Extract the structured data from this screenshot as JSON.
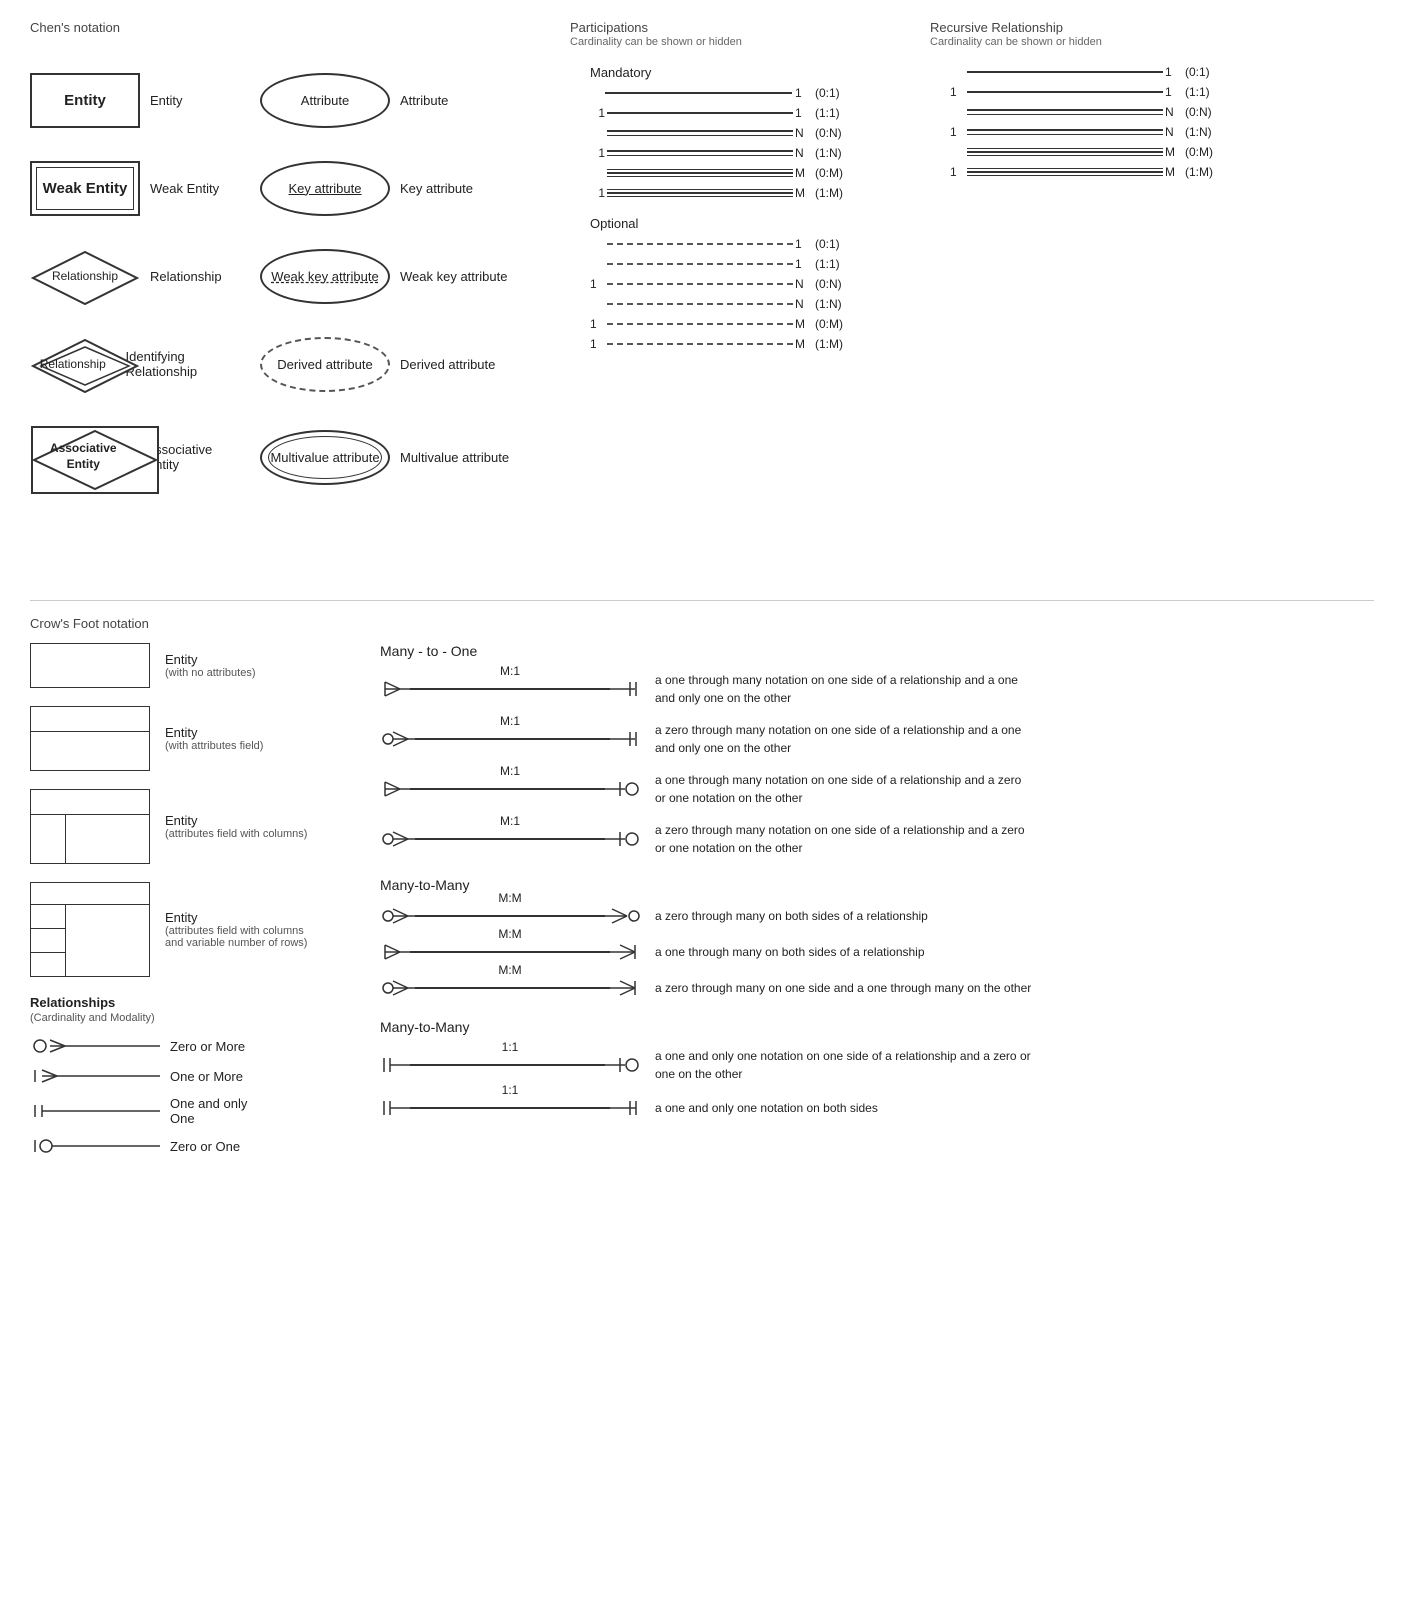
{
  "chens": {
    "title": "Chen's notation",
    "entities": [
      {
        "shape": "entity",
        "label": "Entity",
        "desc": "Entity"
      },
      {
        "shape": "weak-entity",
        "label": "Weak Entity",
        "desc": "Weak Entity"
      },
      {
        "shape": "relationship",
        "label": "Relationship",
        "desc": "Relationship"
      },
      {
        "shape": "identifying-relationship",
        "label": "Relationship",
        "desc": "Identifying Relationship"
      },
      {
        "shape": "associative-entity",
        "label": "Associative\nEntity",
        "desc": "Associative Entity"
      }
    ],
    "attributes": [
      {
        "shape": "attribute",
        "label": "Attribute",
        "desc": "Attribute"
      },
      {
        "shape": "key",
        "label": "Key attribute",
        "desc": "Key attribute"
      },
      {
        "shape": "weak-key",
        "label": "Weak key attribute",
        "desc": "Weak key attribute"
      },
      {
        "shape": "derived",
        "label": "Derived attribute",
        "desc": "Derived attribute"
      },
      {
        "shape": "multivalue",
        "label": "Multivalue attribute",
        "desc": "Multivalue attribute"
      }
    ]
  },
  "participations": {
    "title": "Participations",
    "subtitle": "Cardinality can be shown or hidden",
    "mandatory_label": "Mandatory",
    "optional_label": "Optional",
    "mandatory_rows": [
      {
        "left": "",
        "right": "1",
        "card": "(0:1)"
      },
      {
        "left": "1",
        "right": "1",
        "card": "(1:1)"
      },
      {
        "left": "",
        "right": "N",
        "card": "(0:N)"
      },
      {
        "left": "1",
        "right": "N",
        "card": "(1:N)"
      },
      {
        "left": "",
        "right": "M",
        "card": "(0:M)"
      },
      {
        "left": "1",
        "right": "M",
        "card": "(1:M)"
      }
    ],
    "optional_rows": [
      {
        "left": "",
        "right": "1",
        "card": "(0:1)"
      },
      {
        "left": "",
        "right": "1",
        "card": "(1:1)"
      },
      {
        "left": "1",
        "right": "N",
        "card": "(0:N)"
      },
      {
        "left": "",
        "right": "N",
        "card": "(1:N)"
      },
      {
        "left": "1",
        "right": "M",
        "card": "(0:M)"
      },
      {
        "left": "1",
        "right": "M",
        "card": "(1:M)"
      }
    ]
  },
  "recursive": {
    "title": "Recursive Relationship",
    "subtitle": "Cardinality can be shown or hidden",
    "rows": [
      {
        "left": "",
        "right": "1",
        "card": "(0:1)"
      },
      {
        "left": "1",
        "right": "1",
        "card": "(1:1)"
      },
      {
        "left": "",
        "right": "N",
        "card": "(0:N)"
      },
      {
        "left": "1",
        "right": "N",
        "card": "(1:N)"
      },
      {
        "left": "",
        "right": "M",
        "card": "(0:M)"
      },
      {
        "left": "1",
        "right": "M",
        "card": "(1:M)"
      }
    ]
  },
  "crows": {
    "title": "Crow's Foot notation",
    "entities": [
      {
        "type": "simple",
        "desc": "Entity",
        "subdesc": "(with no attributes)"
      },
      {
        "type": "attr",
        "desc": "Entity",
        "subdesc": "(with attributes field)"
      },
      {
        "type": "cols",
        "desc": "Entity",
        "subdesc": "(attributes field with columns)"
      },
      {
        "type": "varrows",
        "desc": "Entity",
        "subdesc": "(attributes field with columns and variable number of rows)"
      }
    ],
    "relationships_title": "Relationships",
    "relationships_subtitle": "(Cardinality and Modality)",
    "relationship_indicators": [
      {
        "symbol": "zero-or-more",
        "label": "Zero or More"
      },
      {
        "symbol": "one-or-more",
        "label": "One or More"
      },
      {
        "symbol": "one-only",
        "label": "One and only One"
      },
      {
        "symbol": "zero-or-one",
        "label": "Zero or One"
      }
    ],
    "many_to_one_title": "Many - to - One",
    "many_to_one_rows": [
      {
        "label": "M:1",
        "left": "crow-one-more",
        "right": "one-only",
        "desc": "a one through many notation on one side of a relationship and a one and only one on the other"
      },
      {
        "label": "M:1",
        "left": "crow-zero-more",
        "right": "one-only",
        "desc": "a zero through many notation on one side of a relationship and a one and only one on the other"
      },
      {
        "label": "M:1",
        "left": "crow-one-more",
        "right": "zero-one",
        "desc": "a one through many notation on one side of a relationship and a zero or one notation on the other"
      },
      {
        "label": "M:1",
        "left": "crow-zero-more",
        "right": "zero-one",
        "desc": "a zero through many notation on one side of a relationship and a zero or one notation on the other"
      }
    ],
    "many_to_many_title": "Many-to-Many",
    "many_to_many_rows": [
      {
        "label": "M:M",
        "left": "crow-zero-more",
        "right": "crow-zero-more-r",
        "desc": "a zero through many on both sides of a relationship"
      },
      {
        "label": "M:M",
        "left": "crow-one-more",
        "right": "crow-one-more-r",
        "desc": "a one through many on both sides of a relationship"
      },
      {
        "label": "M:M",
        "left": "crow-zero-more",
        "right": "crow-one-more-r",
        "desc": "a zero through many on one side and a one through many on the other"
      }
    ],
    "one_to_one_title": "Many-to-Many",
    "one_to_one_rows": [
      {
        "label": "1:1",
        "left": "one-only",
        "right": "zero-one",
        "desc": "a one and only one notation on one side of a relationship and a zero or one on the other"
      },
      {
        "label": "1:1",
        "left": "one-only",
        "right": "one-only-r",
        "desc": "a one and only one notation on both sides"
      }
    ]
  }
}
